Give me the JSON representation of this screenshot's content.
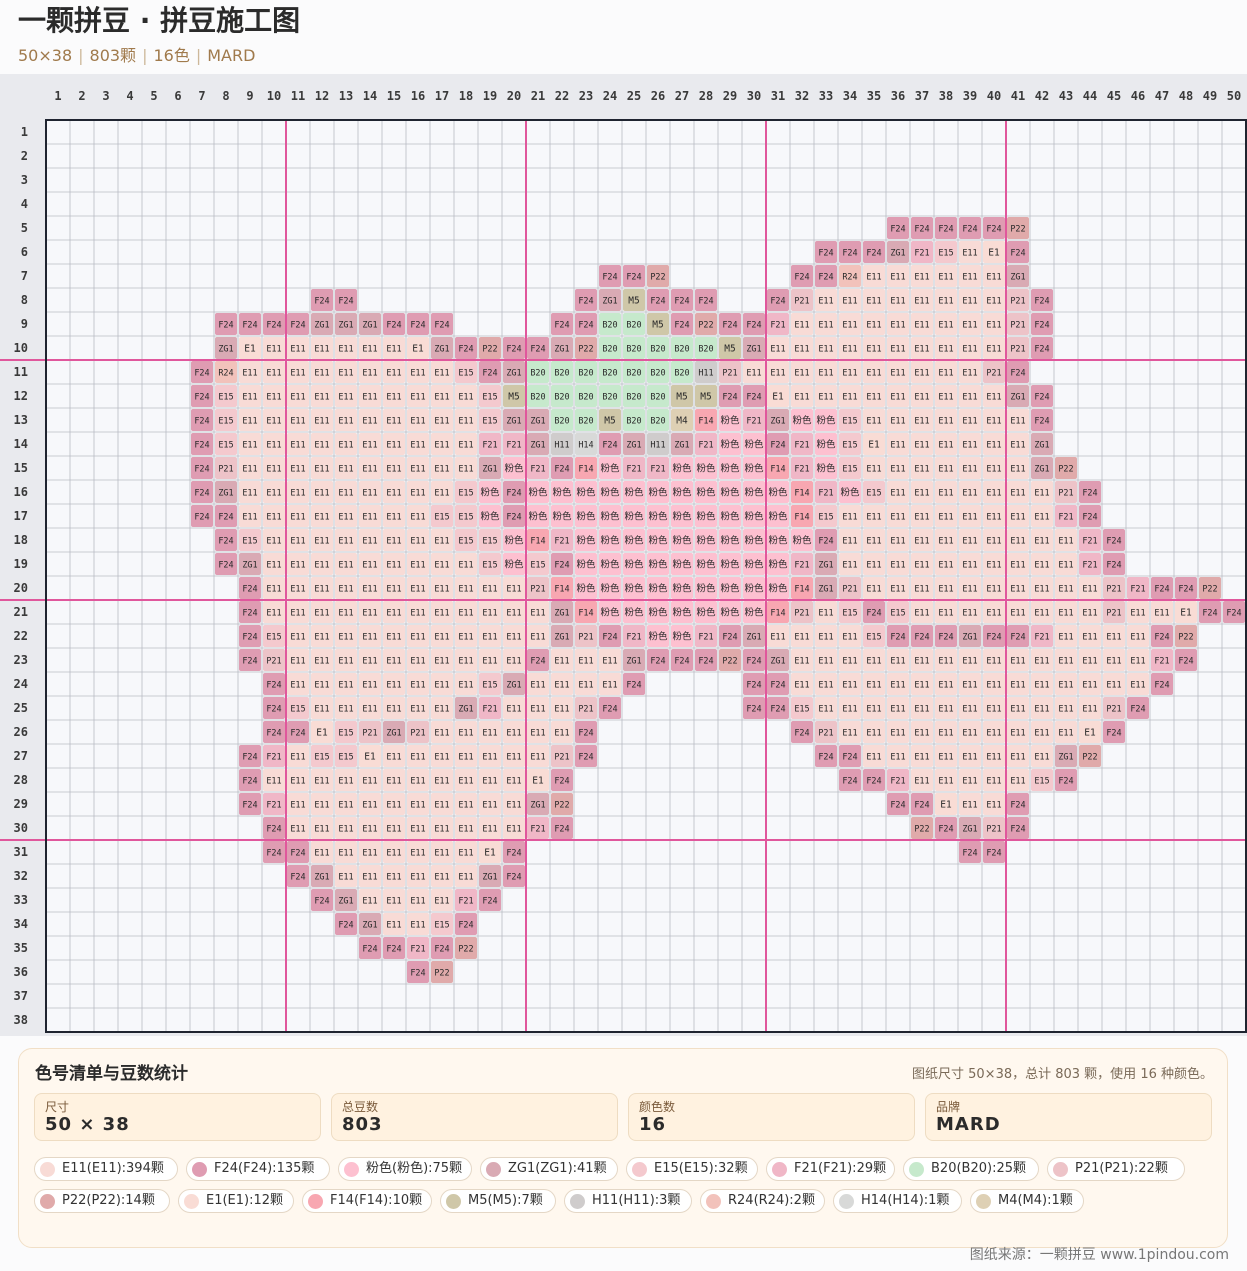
{
  "header": {
    "title": "一颗拼豆 · 拼豆施工图",
    "size": "50×38",
    "beads": "803颗",
    "colors": "16色",
    "brand": "MARD"
  },
  "grid": {
    "cols": 50,
    "rows": 38,
    "major_every": 10,
    "major_line_color": "#e0579c",
    "rows_data": [
      "",
      "",
      "",
      "",
      "36:F24,F24,F24,F24,F24,P22",
      "33:F24,F24,F24,ZG1,F21,E15,E11,E1,F24",
      "24:F24,F24,P22||32:F24,F24,R24,E11,E11,E11,E11,E11,E11,ZG1",
      "12:F24,F24||23:F24,ZG1,M5,F24,F24,F24||31:F24,P21,E11,E11,E11,E11,E11,E11,E11,E11,P21,F24",
      "8:F24,F24,F24,F24,ZG1,ZG1,ZG1,F24,F24,F24||22:F24,F24,B20,B20,M5,F24,P22,F24,F24,F21,E11,E11,E11,E11,E11,E11,E11,E11,E11,P21,F24",
      "8:ZG1,E1,E11,E11,E11,E11,E11,E11,E1,ZG1,F24,P22,F24,F24,ZG1,P22,B20,B20,B20,B20,B20,M5,ZG1,E11,E11,E11,E11,E11,E11,E11,E11,E11,E11,P21,F24",
      "7:F24,R24,E11,E11,E11,E11,E11,E11,E11,E11,E11,E15,F24,ZG1,B20,B20,B20,B20,B20,B20,B20,H11,P21,E11,E11,E11,E11,E11,E11,E11,E11,E11,E11,P21,F24",
      "7:F24,E15,E11,E11,E11,E11,E11,E11,E11,E11,E11,E11,E15,M5,B20,B20,B20,B20,B20,B20,M5,M5,F24,F24,E1,E11,E11,E11,E11,E11,E11,E11,E11,E11,ZG1,F24",
      "7:F24,E15,E11,E11,E11,E11,E11,E11,E11,E11,E11,E11,E15,ZG1,ZG1,B20,B20,M5,B20,B20,M4,F14,粉色,F21,ZG1,粉色,粉色,E15,E11,E11,E11,E11,E11,E11,E11,F24",
      "7:F24,E15,E11,E11,E11,E11,E11,E11,E11,E11,E11,E11,F21,F21,ZG1,H11,H14,F24,ZG1,H11,ZG1,F21,粉色,粉色,F24,F21,粉色,E15,E1,E11,E11,E11,E11,E11,E11,ZG1",
      "7:F24,P21,E11,E11,E11,E11,E11,E11,E11,E11,E11,E11,ZG1,粉色,F21,F24,F14,粉色,F21,F21,粉色,粉色,粉色,粉色,F14,F21,粉色,E15,E11,E11,E11,E11,E11,E11,E11,ZG1,P22",
      "7:F24,ZG1,E11,E11,E11,E11,E11,E11,E11,E11,E11,E15,粉色,F24,粉色,粉色,粉色,粉色,粉色,粉色,粉色,粉色,粉色,粉色,粉色,F14,F21,粉色,E15,E11,E11,E11,E11,E11,E11,E11,P21,F24",
      "7:F24,F24,E11,E11,E11,E11,E11,E11,E11,E11,E15,E15,粉色,F24,粉色,粉色,粉色,粉色,粉色,粉色,粉色,粉色,粉色,粉色,粉色,F14,E15,E11,E11,E11,E11,E11,E11,E11,E11,E11,F21,F24",
      "8:F24,E15,E11,E11,E11,E11,E11,E11,E11,E11,E15,E15,粉色,F14,F21,粉色,粉色,粉色,粉色,粉色,粉色,粉色,粉色,粉色,粉色,F24,E11,E11,E11,E11,E11,E11,E11,E11,E11,E11,F21,F24",
      "8:F24,ZG1,E11,E11,E11,E11,E11,E11,E11,E11,E11,E15,粉色,E15,F24,粉色,粉色,粉色,粉色,粉色,粉色,粉色,粉色,粉色,F21,ZG1,E11,E11,E11,E11,E11,E11,E11,E11,E11,E11,F21,F24",
      "9:F24,E11,E11,E11,E11,E11,E11,E11,E11,E11,E11,E11,P21,F14,粉色,粉色,粉色,粉色,粉色,粉色,粉色,粉色,粉色,F14,ZG1,P21,E11,E11,E11,E11,E11,E11,E11,E11,E11,E11,P21,F21,F24,F24,P22",
      "9:F24,E11,E11,E11,E11,E11,E11,E11,E11,E11,E11,E11,E11,ZG1,F14,粉色,粉色,粉色,粉色,粉色,粉色,粉色,F14,P21,E11,E15,F24,E15,E11,E11,E11,E11,E11,E11,E11,E11,P21,E11,E11,E1,F24,F24",
      "9:F24,E15,E11,E11,E11,E11,E11,E11,E11,E11,E11,E11,E11,ZG1,P21,F24,F21,粉色,粉色,F21,F24,ZG1,E11,E11,E11,E11,E15,F24,F24,F24,ZG1,F24,F24,F21,E11,E11,E11,E11,F24,P22",
      "9:F24,P21,E11,E11,E11,E11,E11,E11,E11,E11,E11,E11,F24,E11,E11,E11,ZG1,F24,F24,F24,P22,F24,ZG1,E11,E11,E11,E11,E11,E11,E11,E11,E11,E11,E11,E11,E11,E11,E11,F21,F24",
      "10:F24,E11,E11,E11,E11,E11,E11,E11,E11,E15,ZG1,E11,E11,E11,E11,F24||30:F24,F24,E11,E11,E11,E11,E11,E11,E11,E11,E11,E11,E11,E11,E11,E11,E11,F24",
      "10:F24,E15,E11,E11,E11,E11,E11,E11,ZG1,F21,E11,E11,E11,P21,F24||30:F24,F24,E15,E11,E11,E11,E11,E11,E11,E11,E11,E11,E11,E11,E11,P21,F24",
      "10:F24,F24,E1,E15,P21,ZG1,P21,E11,E11,E11,E11,E11,E11,F24||32:F24,P21,E11,E11,E11,E11,E11,E11,E11,E11,E11,E11,E1,F24",
      "9:F24,F21,E11,E15,E15,E1,E11,E11,E11,E11,E11,E11,E11,P21,F24||33:F24,F24,E11,E11,E11,E11,E11,E11,E11,E11,ZG1,P22",
      "9:F24,E11,E11,E11,E11,E11,E11,E11,E11,E11,E11,E11,E1,F24||34:F24,F24,F21,E11,E11,E11,E11,E11,E15,F24",
      "9:F24,F21,E11,E11,E11,E11,E11,E11,E11,E11,E11,E11,ZG1,P22||36:F24,F24,E1,E11,E11,F24",
      "10:F24,E11,E11,E11,E11,E11,E11,E11,E11,E11,E11,F21,F24||37:P22,F24,ZG1,P21,F24",
      "10:F24,F24,E11,E11,E11,E11,E11,E11,E11,E1,F24||39:F24,F24",
      "11:F24,ZG1,E11,E11,E11,E11,E11,E11,ZG1,F24",
      "12:F24,ZG1,E11,E11,E11,E11,F21,F24",
      "13:F24,ZG1,E11,E11,E15,F24",
      "14:F24,F24,F21,F24,P22",
      "16:F24,P22",
      "",
      ""
    ]
  },
  "palette": {
    "E11": "#f8dbd6",
    "F24": "#df9cb2",
    "粉色": "#fdc0d0",
    "ZG1": "#d9aab4",
    "E15": "#f4c9ce",
    "F21": "#f0b7c7",
    "B20": "#c6e9cc",
    "P21": "#edc3c8",
    "P22": "#e0aaaa",
    "E1": "#f9dcd5",
    "F14": "#f8a7b1",
    "M5": "#cfc7a8",
    "H11": "#cfcccc",
    "R24": "#f2c2bb",
    "H14": "#d8d9d8",
    "M4": "#ded0b4"
  },
  "panel": {
    "title": "色号清单与豆数统计",
    "note": "图纸尺寸 50×38，总计 803 颗，使用 16 种颜色。",
    "stats": [
      {
        "label": "尺寸",
        "value": "50 × 38"
      },
      {
        "label": "总豆数",
        "value": "803"
      },
      {
        "label": "颜色数",
        "value": "16"
      },
      {
        "label": "品牌",
        "value": "MARD"
      }
    ],
    "counts": [
      {
        "code": "E11",
        "text": "E11(E11):394颗"
      },
      {
        "code": "F24",
        "text": "F24(F24):135颗"
      },
      {
        "code": "粉色",
        "text": "粉色(粉色):75颗"
      },
      {
        "code": "ZG1",
        "text": "ZG1(ZG1):41颗"
      },
      {
        "code": "E15",
        "text": "E15(E15):32颗"
      },
      {
        "code": "F21",
        "text": "F21(F21):29颗"
      },
      {
        "code": "B20",
        "text": "B20(B20):25颗"
      },
      {
        "code": "P21",
        "text": "P21(P21):22颗"
      },
      {
        "code": "P22",
        "text": "P22(P22):14颗"
      },
      {
        "code": "E1",
        "text": "E1(E1):12颗"
      },
      {
        "code": "F14",
        "text": "F14(F14):10颗"
      },
      {
        "code": "M5",
        "text": "M5(M5):7颗"
      },
      {
        "code": "H11",
        "text": "H11(H11):3颗"
      },
      {
        "code": "R24",
        "text": "R24(R24):2颗"
      },
      {
        "code": "H14",
        "text": "H14(H14):1颗"
      },
      {
        "code": "M4",
        "text": "M4(M4):1颗"
      }
    ]
  },
  "footer": "图纸来源：一颗拼豆 www.1pindou.com"
}
